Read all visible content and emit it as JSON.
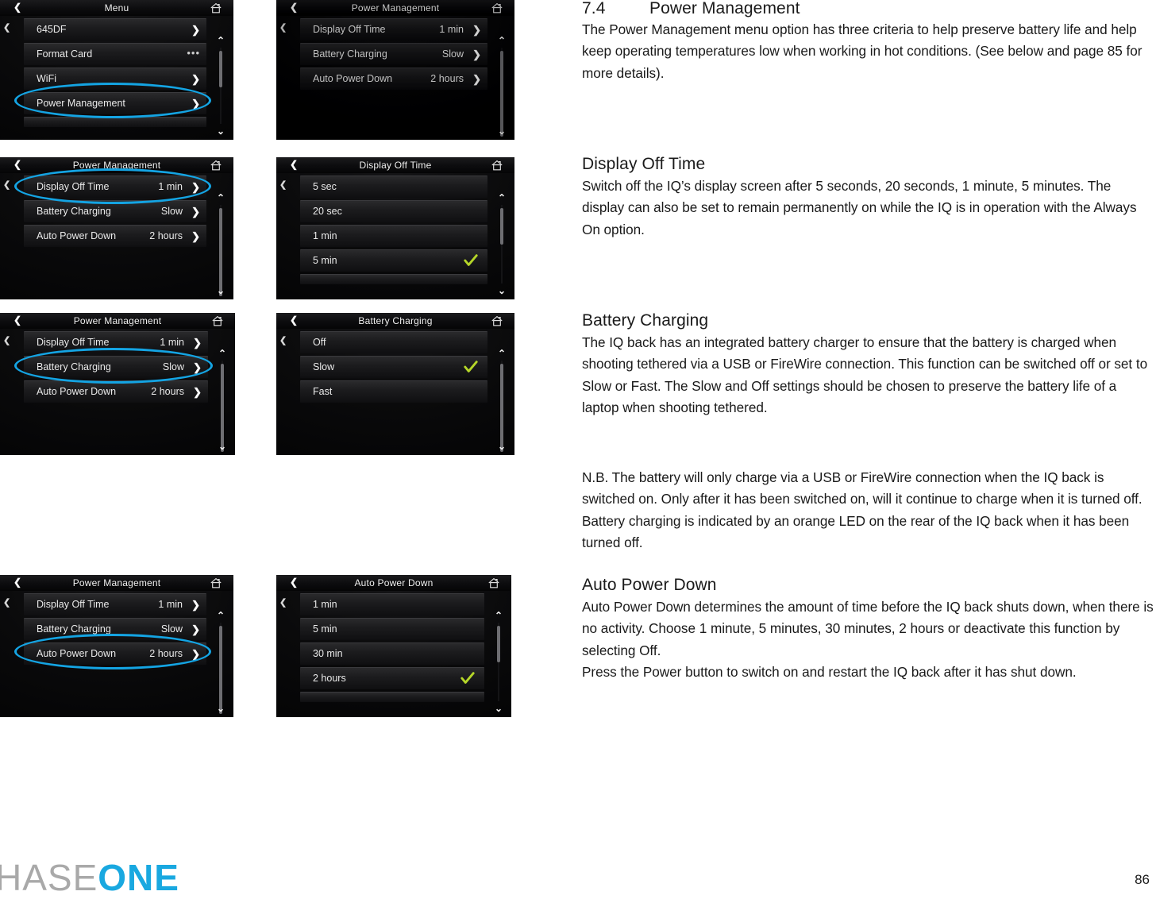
{
  "accent": {
    "highlight_ellipse": "#14a4e3",
    "logo_blue": "#19a8e0",
    "logo_grey": "#a9a9a9",
    "checkmark_green": "#b5d629"
  },
  "screens": [
    {
      "id": "menu",
      "title": "Menu",
      "back_icon": "chevron-left-icon",
      "home_icon": "home-icon",
      "rows": [
        {
          "label": "645DF",
          "value": "",
          "accessory": "chevron"
        },
        {
          "label": "Format Card",
          "value": "",
          "accessory": "ellipsis"
        },
        {
          "label": "WiFi",
          "value": "",
          "accessory": "chevron"
        },
        {
          "label": "Power Management",
          "value": "",
          "accessory": "chevron"
        }
      ],
      "highlight_row": 3
    },
    {
      "id": "power-management-overview",
      "title": "Power Management",
      "back_icon": "chevron-left-icon",
      "home_icon": "home-icon",
      "rows": [
        {
          "label": "Display Off Time",
          "value": "1 min",
          "accessory": "chevron"
        },
        {
          "label": "Battery Charging",
          "value": "Slow",
          "accessory": "chevron"
        },
        {
          "label": "Auto Power Down",
          "value": "2 hours",
          "accessory": "chevron"
        }
      ],
      "highlight_row": null
    },
    {
      "id": "power-management-display-off",
      "title": "Power Management",
      "back_icon": "chevron-left-icon",
      "home_icon": "home-icon",
      "rows": [
        {
          "label": "Display Off Time",
          "value": "1 min",
          "accessory": "chevron"
        },
        {
          "label": "Battery Charging",
          "value": "Slow",
          "accessory": "chevron"
        },
        {
          "label": "Auto Power Down",
          "value": "2 hours",
          "accessory": "chevron"
        }
      ],
      "highlight_row": 0
    },
    {
      "id": "display-off-time",
      "title": "Display Off Time",
      "back_icon": "chevron-left-icon",
      "home_icon": "home-icon",
      "rows": [
        {
          "label": "5 sec",
          "value": "",
          "accessory": "none"
        },
        {
          "label": "20 sec",
          "value": "",
          "accessory": "none"
        },
        {
          "label": "1 min",
          "value": "",
          "accessory": "none"
        },
        {
          "label": "5 min",
          "value": "",
          "accessory": "check"
        }
      ],
      "highlight_row": null
    },
    {
      "id": "power-management-battery",
      "title": "Power Management",
      "back_icon": "chevron-left-icon",
      "home_icon": "home-icon",
      "rows": [
        {
          "label": "Display Off Time",
          "value": "1 min",
          "accessory": "chevron"
        },
        {
          "label": "Battery Charging",
          "value": "Slow",
          "accessory": "chevron"
        },
        {
          "label": "Auto Power Down",
          "value": "2 hours",
          "accessory": "chevron"
        }
      ],
      "highlight_row": 1
    },
    {
      "id": "battery-charging",
      "title": "Battery Charging",
      "back_icon": "chevron-left-icon",
      "home_icon": "home-icon",
      "rows": [
        {
          "label": "Off",
          "value": "",
          "accessory": "none"
        },
        {
          "label": "Slow",
          "value": "",
          "accessory": "check"
        },
        {
          "label": "Fast",
          "value": "",
          "accessory": "none"
        }
      ],
      "highlight_row": null
    },
    {
      "id": "power-management-auto-power-down",
      "title": "Power Management",
      "back_icon": "chevron-left-icon",
      "home_icon": "home-icon",
      "rows": [
        {
          "label": "Display Off Time",
          "value": "1 min",
          "accessory": "chevron"
        },
        {
          "label": "Battery Charging",
          "value": "Slow",
          "accessory": "chevron"
        },
        {
          "label": "Auto Power Down",
          "value": "2 hours",
          "accessory": "chevron"
        }
      ],
      "highlight_row": 2
    },
    {
      "id": "auto-power-down",
      "title": "Auto Power Down",
      "back_icon": "chevron-left-icon",
      "home_icon": "home-icon",
      "rows": [
        {
          "label": "1 min",
          "value": "",
          "accessory": "none"
        },
        {
          "label": "5 min",
          "value": "",
          "accessory": "none"
        },
        {
          "label": "30 min",
          "value": "",
          "accessory": "none"
        },
        {
          "label": "2 hours",
          "value": "",
          "accessory": "check"
        }
      ],
      "highlight_row": null
    }
  ],
  "article": {
    "s1": {
      "number": "7.4",
      "heading": "Power Management",
      "body": "The Power Management menu option has three criteria to help preserve battery life and help keep operating temperatures low when working in hot conditions. (See below and page 85 for more details)."
    },
    "s2": {
      "heading": "Display Off Time",
      "body": "Switch off the IQ’s display screen after 5 seconds, 20 seconds, 1 minute, 5 minutes. The display can also be set to remain permanently on while the IQ is in operation with the Always On option."
    },
    "s3": {
      "heading": "Battery Charging",
      "body": "The IQ back has an integrated battery charger to ensure that the battery is charged when shooting tethered via a USB or FireWire connection. This function can be switched off or set to Slow or Fast. The Slow and Off settings should be chosen to preserve the battery life of a laptop when shooting tethered."
    },
    "s4": {
      "body": "N.B. The battery will only charge via a USB or FireWire connection when the IQ back is switched on. Only after it has been switched on, will it continue to charge when it is turned off. Battery charging is indicated by an orange LED on the rear of the IQ back when it has been turned off."
    },
    "s5": {
      "heading": "Auto Power Down",
      "body": "Auto Power Down determines the amount of time before the IQ back shuts down, when there is no activity. Choose 1 minute, 5 minutes, 30 minutes, 2 hours or deactivate this function by selecting Off.\nPress the Power button to switch on and restart the IQ back after it has shut down."
    }
  },
  "footer": {
    "logo_grey": "HASE",
    "logo_blue": "ONE",
    "page_number": "86"
  }
}
